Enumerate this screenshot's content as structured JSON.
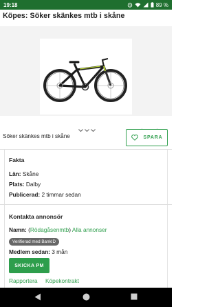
{
  "status_bar": {
    "time": "19:18",
    "battery": "89 %"
  },
  "title": "Köpes: Söker skänkes mtb i skåne",
  "ad_name": "Söker skänkes mtb i skåne",
  "save_label": "SPARA",
  "facts": {
    "heading": "Fakta",
    "rows": [
      {
        "label": "Län:",
        "value": "Skåne"
      },
      {
        "label": "Plats:",
        "value": "Dalby"
      },
      {
        "label": "Publicerad:",
        "value": "2 timmar sedan"
      }
    ]
  },
  "contact": {
    "heading": "Kontakta annonsör",
    "name_label": "Namn:",
    "name_open": "(",
    "name_link": "Rödagåsenmtb",
    "name_close": ")",
    "all_ads": "Alla annonser",
    "verified": "Verifierad med BankID",
    "member_label": "Medlem sedan:",
    "member_value": "3 mån",
    "message_button": "SKICKA PM"
  },
  "links": {
    "report": "Rapportera",
    "contract": "Köpekontrakt"
  },
  "colors": {
    "status_bar": "#1f6f2f",
    "accent": "#2e9e4c",
    "badge": "#666666"
  },
  "icons": [
    "alarm-icon",
    "wifi-icon",
    "signal-icon",
    "battery-icon",
    "heart-icon",
    "chevron-left-icon",
    "chevron-right-icon",
    "back-icon",
    "home-icon",
    "recents-icon"
  ]
}
